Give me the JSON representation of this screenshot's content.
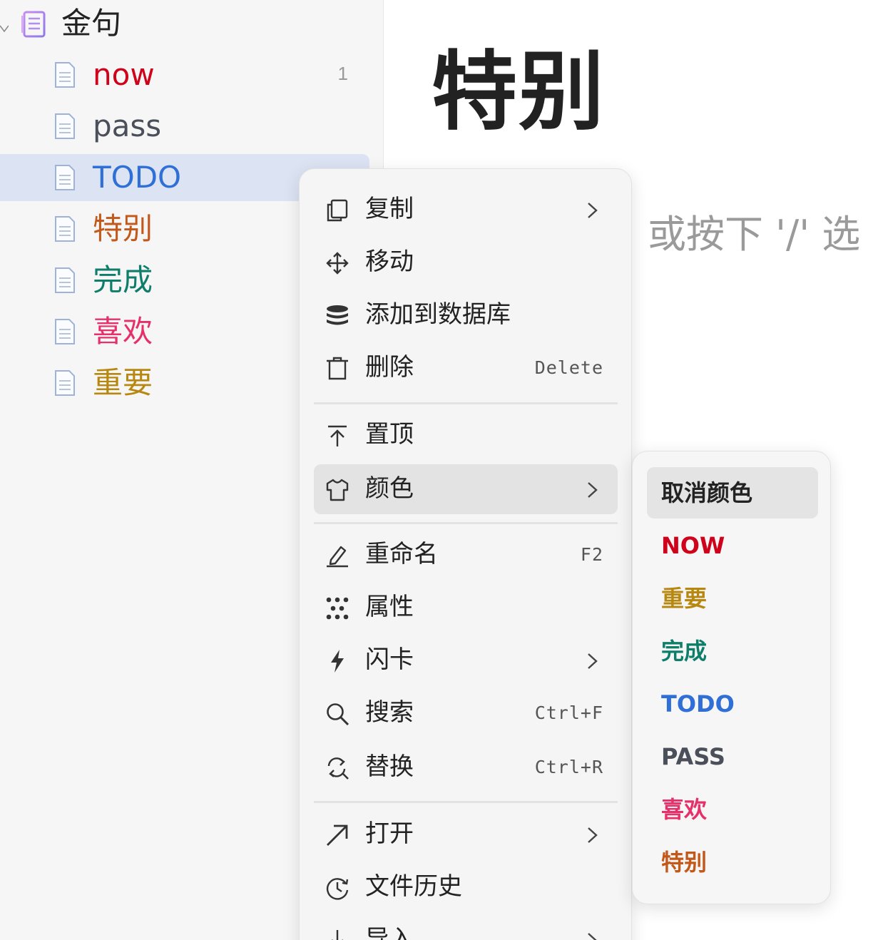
{
  "sidebar": {
    "notebook": {
      "title": "金句",
      "icon": "notebook-icon"
    },
    "docs": [
      {
        "title": "now",
        "color": "#d0021b",
        "count": "1"
      },
      {
        "title": "pass",
        "color": "#4a4f5a",
        "count": ""
      },
      {
        "title": "TODO",
        "color": "#2f6fd6",
        "count": "",
        "selected": true
      },
      {
        "title": "特别",
        "color": "#c2591a",
        "count": ""
      },
      {
        "title": "完成",
        "color": "#0e7d6a",
        "count": ""
      },
      {
        "title": "喜欢",
        "color": "#e5306b",
        "count": ""
      },
      {
        "title": "重要",
        "color": "#b8870f",
        "count": ""
      }
    ]
  },
  "main": {
    "title": "特别",
    "placeholder": "或按下 '/' 选"
  },
  "context_menu": {
    "items": [
      {
        "label": "复制",
        "icon": "copy-icon",
        "shortcut": "",
        "submenu": true
      },
      {
        "label": "移动",
        "icon": "move-icon",
        "shortcut": "",
        "submenu": false
      },
      {
        "label": "添加到数据库",
        "icon": "database-icon",
        "shortcut": "",
        "submenu": false
      },
      {
        "label": "删除",
        "icon": "trash-icon",
        "shortcut": "Delete",
        "submenu": false
      },
      {
        "label": "置顶",
        "icon": "pin-top-icon",
        "shortcut": "",
        "submenu": false
      },
      {
        "label": "颜色",
        "icon": "shirt-icon",
        "shortcut": "",
        "submenu": true,
        "active": true
      },
      {
        "label": "重命名",
        "icon": "pencil-icon",
        "shortcut": "F2",
        "submenu": false
      },
      {
        "label": "属性",
        "icon": "dots-grid-icon",
        "shortcut": "",
        "submenu": false
      },
      {
        "label": "闪卡",
        "icon": "lightning-icon",
        "shortcut": "",
        "submenu": true
      },
      {
        "label": "搜索",
        "icon": "search-icon",
        "shortcut": "Ctrl+F",
        "submenu": false
      },
      {
        "label": "替换",
        "icon": "replace-icon",
        "shortcut": "Ctrl+R",
        "submenu": false
      },
      {
        "label": "打开",
        "icon": "open-arrow-icon",
        "shortcut": "",
        "submenu": true
      },
      {
        "label": "文件历史",
        "icon": "history-icon",
        "shortcut": "",
        "submenu": false
      },
      {
        "label": "导入",
        "icon": "import-icon",
        "shortcut": "",
        "submenu": true
      }
    ]
  },
  "color_submenu": {
    "items": [
      {
        "label": "取消颜色",
        "color": "#222222",
        "active": true
      },
      {
        "label": "NOW",
        "color": "#d0021b"
      },
      {
        "label": "重要",
        "color": "#b8870f"
      },
      {
        "label": "完成",
        "color": "#0e7d6a"
      },
      {
        "label": "TODO",
        "color": "#2f6fd6"
      },
      {
        "label": "PASS",
        "color": "#4a4f5a"
      },
      {
        "label": "喜欢",
        "color": "#e5306b"
      },
      {
        "label": "特别",
        "color": "#c2591a"
      }
    ]
  }
}
